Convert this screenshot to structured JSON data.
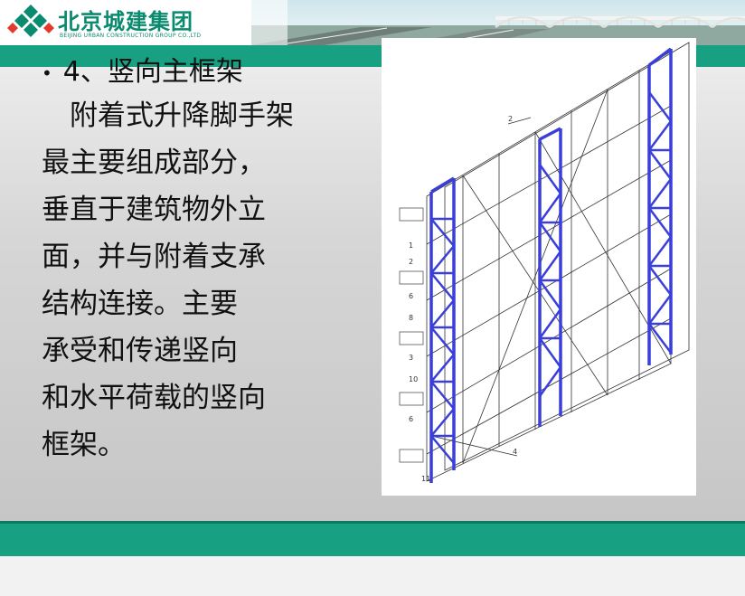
{
  "brand": {
    "name": "北京城建集团",
    "subtitle": "BEIJING URBAN CONSTRUCTION GROUP CO.,LTD",
    "color": "#0a8a6e",
    "logo_icon": "diamond-cluster-logo"
  },
  "banner": {
    "icon": "bridge-highway-photo"
  },
  "slide": {
    "bullet": "•",
    "title": "4、竖向主框架",
    "body_lines": [
      "　附着式升降脚手架",
      "最主要组成部分，",
      "垂直于建筑物外立",
      "面，并与附着支承",
      "结构连接。主要",
      "承受和传递竖向",
      "和水平荷载的竖向",
      "框架。"
    ]
  },
  "figure": {
    "icon": "scaffold-frame-drawing",
    "labels": [
      "1",
      "2",
      "3",
      "4",
      "6",
      "8",
      "10",
      "11"
    ]
  },
  "colors": {
    "band": "#17a082",
    "frame_highlight": "#3a3fd9",
    "line": "#333333"
  }
}
